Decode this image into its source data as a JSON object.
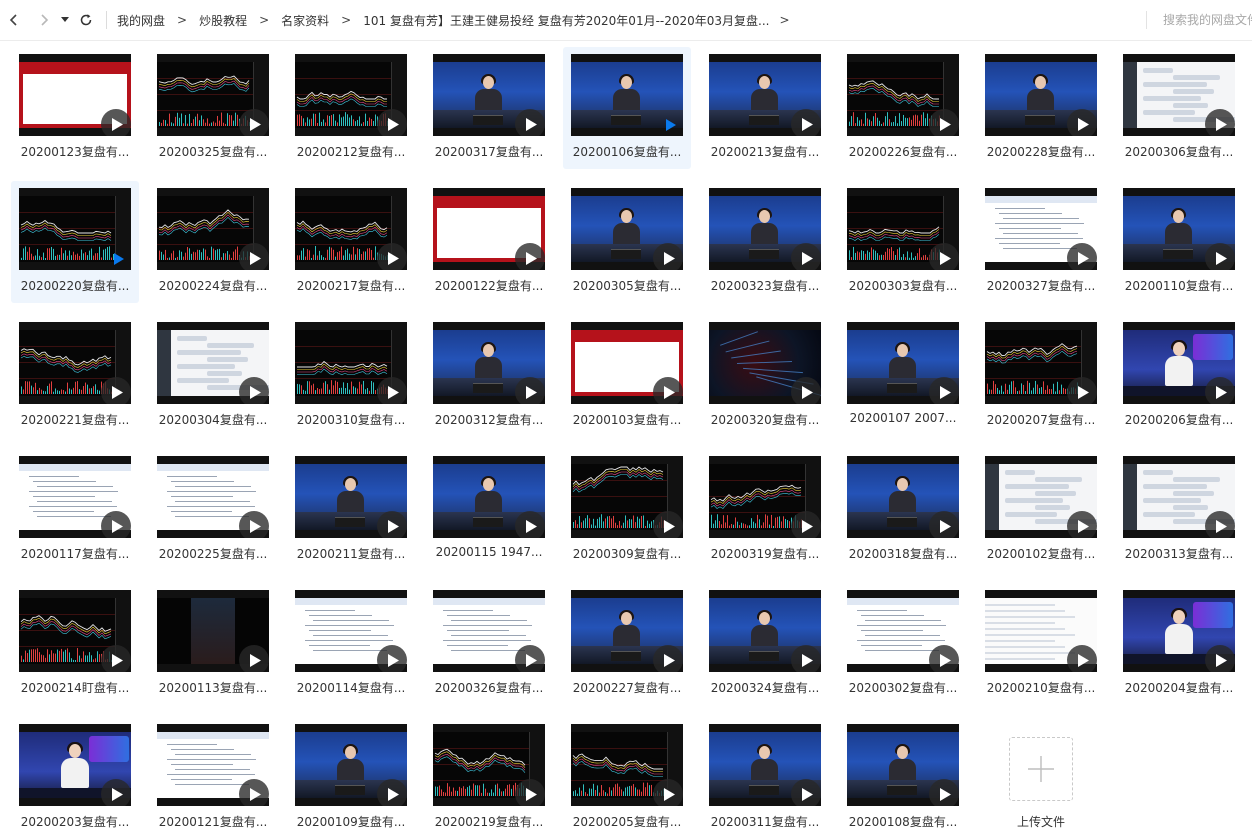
{
  "nav": {
    "back_icon": "chevron-left-icon",
    "forward_icon": "chevron-right-icon",
    "dropdown_icon": "caret-down-icon",
    "refresh_icon": "refresh-icon"
  },
  "breadcrumb": {
    "items": [
      "我的网盘",
      "炒股教程",
      "名家资料",
      "101 复盘有芳】王建王健易投经 复盘有芳2020年01月--2020年03月复盘..."
    ],
    "separator": ">"
  },
  "search": {
    "placeholder": "搜索我的网盘文件"
  },
  "colors": {
    "accent": "#0a7aee",
    "selected_bg": "#eef5fd"
  },
  "files": [
    {
      "name": "20200123复盘有...",
      "thumb": "title",
      "selected": false
    },
    {
      "name": "20200325复盘有...",
      "thumb": "chart",
      "selected": false
    },
    {
      "name": "20200212复盘有...",
      "thumb": "chart",
      "selected": false
    },
    {
      "name": "20200317复盘有...",
      "thumb": "anchor",
      "selected": false
    },
    {
      "name": "20200106复盘有...",
      "thumb": "anchor",
      "selected": true
    },
    {
      "name": "20200213复盘有...",
      "thumb": "anchor",
      "selected": false
    },
    {
      "name": "20200226复盘有...",
      "thumb": "chart",
      "selected": false
    },
    {
      "name": "20200228复盘有...",
      "thumb": "anchor",
      "selected": false
    },
    {
      "name": "20200306复盘有...",
      "thumb": "chat",
      "selected": false
    },
    {
      "name": "20200220复盘有...",
      "thumb": "chart",
      "selected": true
    },
    {
      "name": "20200224复盘有...",
      "thumb": "chart",
      "selected": false
    },
    {
      "name": "20200217复盘有...",
      "thumb": "chart",
      "selected": false
    },
    {
      "name": "20200122复盘有...",
      "thumb": "title",
      "selected": false
    },
    {
      "name": "20200305复盘有...",
      "thumb": "anchor",
      "selected": false
    },
    {
      "name": "20200323复盘有...",
      "thumb": "anchor",
      "selected": false
    },
    {
      "name": "20200303复盘有...",
      "thumb": "chart",
      "selected": false
    },
    {
      "name": "20200327复盘有...",
      "thumb": "doc",
      "selected": false
    },
    {
      "name": "20200110复盘有...",
      "thumb": "anchor",
      "selected": false
    },
    {
      "name": "20200221复盘有...",
      "thumb": "chart",
      "selected": false
    },
    {
      "name": "20200304复盘有...",
      "thumb": "chat",
      "selected": false
    },
    {
      "name": "20200310复盘有...",
      "thumb": "chart",
      "selected": false
    },
    {
      "name": "20200312复盘有...",
      "thumb": "anchor",
      "selected": false
    },
    {
      "name": "20200103复盘有...",
      "thumb": "title",
      "selected": false
    },
    {
      "name": "20200320复盘有...",
      "thumb": "tech",
      "selected": false
    },
    {
      "name": "20200107 2007...",
      "thumb": "anchor",
      "selected": false
    },
    {
      "name": "20200207复盘有...",
      "thumb": "chart",
      "selected": false
    },
    {
      "name": "20200206复盘有...",
      "thumb": "studio",
      "selected": false
    },
    {
      "name": "20200117复盘有...",
      "thumb": "doc",
      "selected": false
    },
    {
      "name": "20200225复盘有...",
      "thumb": "doc",
      "selected": false
    },
    {
      "name": "20200211复盘有...",
      "thumb": "anchor",
      "selected": false
    },
    {
      "name": "20200115 1947...",
      "thumb": "anchor",
      "selected": false
    },
    {
      "name": "20200309复盘有...",
      "thumb": "chart",
      "selected": false
    },
    {
      "name": "20200319复盘有...",
      "thumb": "chart",
      "selected": false
    },
    {
      "name": "20200318复盘有...",
      "thumb": "anchor",
      "selected": false
    },
    {
      "name": "20200102复盘有...",
      "thumb": "chat",
      "selected": false
    },
    {
      "name": "20200313复盘有...",
      "thumb": "chat",
      "selected": false
    },
    {
      "name": "20200214盯盘有...",
      "thumb": "chart",
      "selected": false
    },
    {
      "name": "20200113复盘有...",
      "thumb": "dark",
      "selected": false
    },
    {
      "name": "20200114复盘有...",
      "thumb": "doc",
      "selected": false
    },
    {
      "name": "20200326复盘有...",
      "thumb": "doc",
      "selected": false
    },
    {
      "name": "20200227复盘有...",
      "thumb": "anchor",
      "selected": false
    },
    {
      "name": "20200324复盘有...",
      "thumb": "anchor",
      "selected": false
    },
    {
      "name": "20200302复盘有...",
      "thumb": "doc",
      "selected": false
    },
    {
      "name": "20200210复盘有...",
      "thumb": "files",
      "selected": false
    },
    {
      "name": "20200204复盘有...",
      "thumb": "studio",
      "selected": false
    },
    {
      "name": "20200203复盘有...",
      "thumb": "studio",
      "selected": false
    },
    {
      "name": "20200121复盘有...",
      "thumb": "doc",
      "selected": false
    },
    {
      "name": "20200109复盘有...",
      "thumb": "anchor",
      "selected": false
    },
    {
      "name": "20200219复盘有...",
      "thumb": "chart",
      "selected": false
    },
    {
      "name": "20200205复盘有...",
      "thumb": "chart",
      "selected": false
    },
    {
      "name": "20200311复盘有...",
      "thumb": "anchor",
      "selected": false
    },
    {
      "name": "20200108复盘有...",
      "thumb": "anchor",
      "selected": false
    }
  ],
  "upload": {
    "label": "上传文件",
    "icon": "plus-icon"
  }
}
